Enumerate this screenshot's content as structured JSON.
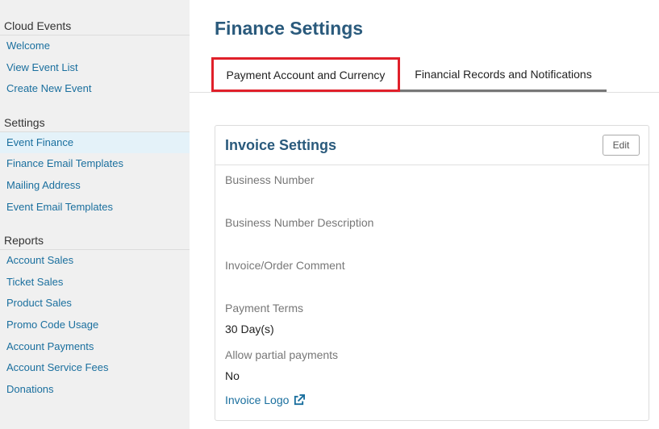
{
  "sidebar": {
    "sections": [
      {
        "title": "Cloud Events",
        "items": [
          {
            "label": "Welcome"
          },
          {
            "label": "View Event List"
          },
          {
            "label": "Create New Event"
          }
        ]
      },
      {
        "title": "Settings",
        "items": [
          {
            "label": "Event Finance",
            "active": true
          },
          {
            "label": "Finance Email Templates"
          },
          {
            "label": "Mailing Address"
          },
          {
            "label": "Event Email Templates"
          }
        ]
      },
      {
        "title": "Reports",
        "items": [
          {
            "label": "Account Sales"
          },
          {
            "label": "Ticket Sales"
          },
          {
            "label": "Product Sales"
          },
          {
            "label": "Promo Code Usage"
          },
          {
            "label": "Account Payments"
          },
          {
            "label": "Account Service Fees"
          },
          {
            "label": "Donations"
          }
        ]
      }
    ]
  },
  "main": {
    "title": "Finance Settings",
    "tabs": [
      {
        "label": "Payment Account and Currency",
        "highlighted": true
      },
      {
        "label": "Financial Records and Notifications"
      }
    ],
    "card": {
      "title": "Invoice Settings",
      "edit_label": "Edit",
      "fields": [
        {
          "label": "Business Number",
          "value": ""
        },
        {
          "label": "Business Number Description",
          "value": ""
        },
        {
          "label": "Invoice/Order Comment",
          "value": ""
        },
        {
          "label": "Payment Terms",
          "value": "30 Day(s)"
        },
        {
          "label": "Allow partial payments",
          "value": "No"
        }
      ],
      "logo_link": "Invoice Logo",
      "logo_icon": "external-link-icon"
    }
  },
  "colors": {
    "accent_link": "#1a6f9e",
    "title": "#2a5a7c",
    "highlight_box": "#e0202a",
    "active_nav_bg": "#e4f2f9"
  }
}
